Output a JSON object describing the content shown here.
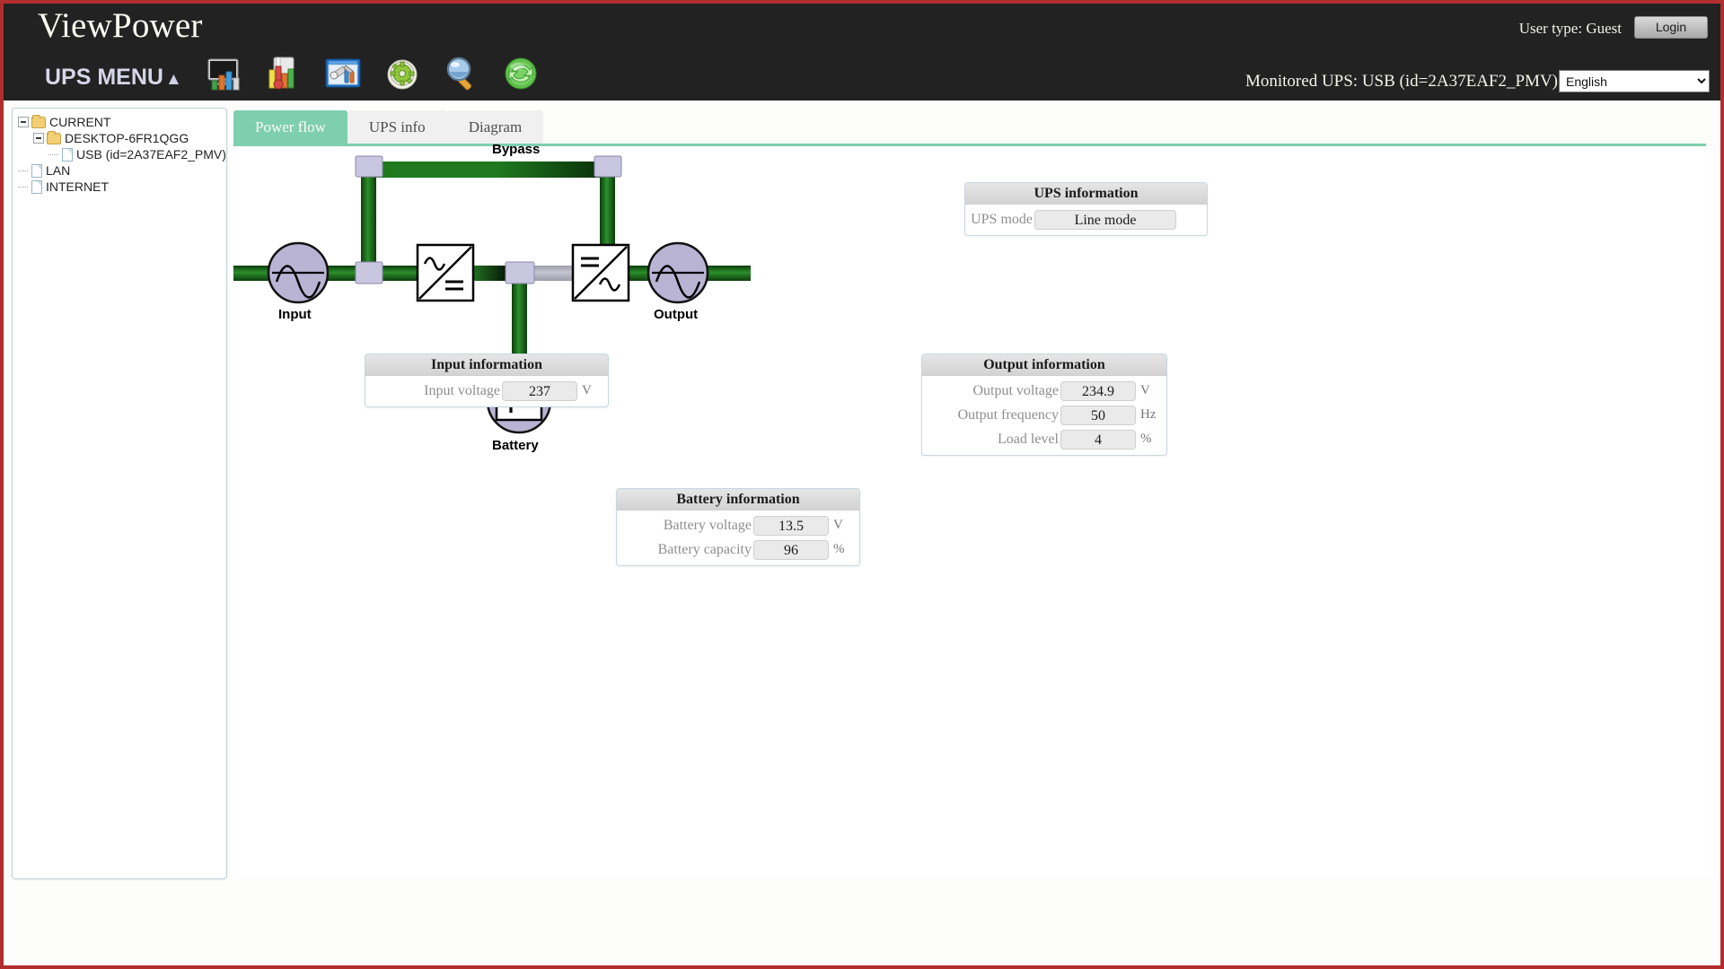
{
  "app": {
    "brand": "ViewPower",
    "menu_label": "UPS MENU",
    "menu_caret": "▲"
  },
  "header": {
    "user_type": "User type: Guest",
    "login_label": "Login",
    "monitored_ups": "Monitored UPS: USB (id=2A37EAF2_PMV)",
    "language_selected": "English",
    "language_options": [
      "English"
    ]
  },
  "toolbar": {
    "icons": [
      {
        "name": "monitor-chart-icon",
        "title": "Monitor"
      },
      {
        "name": "report-chart-icon",
        "title": "Report"
      },
      {
        "name": "settings-window-icon",
        "title": "UPS setting"
      },
      {
        "name": "gear-icon",
        "title": "System configuration"
      },
      {
        "name": "magnifier-icon",
        "title": "Search"
      },
      {
        "name": "refresh-icon",
        "title": "Refresh"
      }
    ]
  },
  "sidebar": {
    "nodes": [
      {
        "label": "CURRENT",
        "type": "folder",
        "depth": 0,
        "expandable": true
      },
      {
        "label": "DESKTOP-6FR1QGG",
        "type": "folder",
        "depth": 1,
        "expandable": true
      },
      {
        "label": "USB (id=2A37EAF2_PMV)",
        "type": "file",
        "depth": 2,
        "expandable": false
      },
      {
        "label": "LAN",
        "type": "file",
        "depth": 0,
        "expandable": false
      },
      {
        "label": "INTERNET",
        "type": "file",
        "depth": 0,
        "expandable": false
      }
    ]
  },
  "tabs": [
    {
      "label": "Power flow",
      "active": true
    },
    {
      "label": "UPS info",
      "active": false
    },
    {
      "label": "Diagram",
      "active": false
    }
  ],
  "diagram": {
    "labels": {
      "bypass": "Bypass",
      "input": "Input",
      "output": "Output",
      "battery": "Battery"
    },
    "colors": {
      "flow_active": "#1c7a1c",
      "flow_inactive": "#b9b9c4",
      "node_fill": "#b9b4d4",
      "connector": "#c9c6e0"
    }
  },
  "panels": {
    "ups": {
      "title": "UPS information",
      "rows": [
        {
          "label": "UPS mode",
          "value": "Line mode",
          "unit": "",
          "wide": true
        }
      ]
    },
    "input": {
      "title": "Input information",
      "rows": [
        {
          "label": "Input voltage",
          "value": "237",
          "unit": "V",
          "wide": false
        }
      ]
    },
    "output": {
      "title": "Output information",
      "rows": [
        {
          "label": "Output voltage",
          "value": "234.9",
          "unit": "V",
          "wide": false
        },
        {
          "label": "Output frequency",
          "value": "50",
          "unit": "Hz",
          "wide": false
        },
        {
          "label": "Load level",
          "value": "4",
          "unit": "%",
          "wide": false
        }
      ]
    },
    "battery": {
      "title": "Battery information",
      "rows": [
        {
          "label": "Battery voltage",
          "value": "13.5",
          "unit": "V",
          "wide": false
        },
        {
          "label": "Battery capacity",
          "value": "96",
          "unit": "%",
          "wide": false
        }
      ]
    }
  }
}
